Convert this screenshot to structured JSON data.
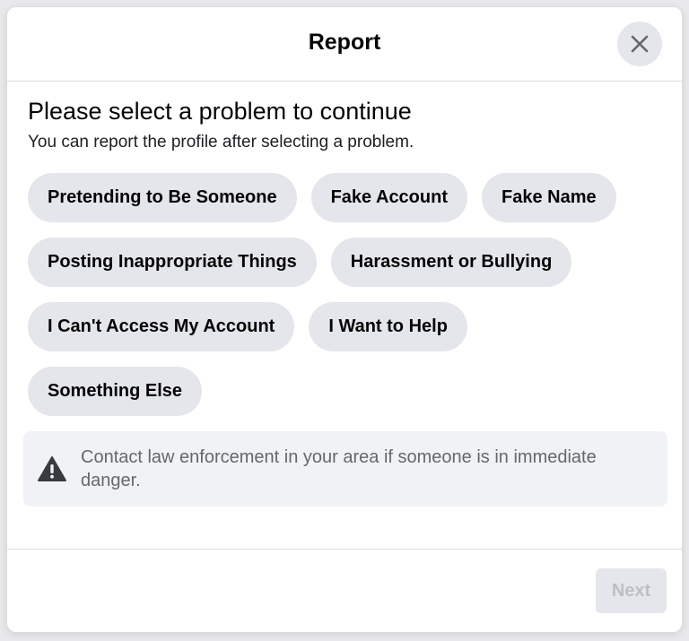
{
  "dialog": {
    "title": "Report",
    "close_icon": "close-icon"
  },
  "content": {
    "heading": "Please select a problem to continue",
    "subheading": "You can report the profile after selecting a problem."
  },
  "options": [
    "Pretending to Be Someone",
    "Fake Account",
    "Fake Name",
    "Posting Inappropriate Things",
    "Harassment or Bullying",
    "I Can't Access My Account",
    "I Want to Help",
    "Something Else"
  ],
  "notice": {
    "icon": "warning-icon",
    "text": "Contact law enforcement in your area if someone is in immediate danger."
  },
  "footer": {
    "next_label": "Next",
    "next_disabled": true
  },
  "colors": {
    "chip_bg": "#e4e6eb",
    "notice_bg": "#f0f2f5",
    "text_primary": "#050505",
    "text_secondary": "#65676b",
    "disabled_text": "#bcc0c4"
  }
}
